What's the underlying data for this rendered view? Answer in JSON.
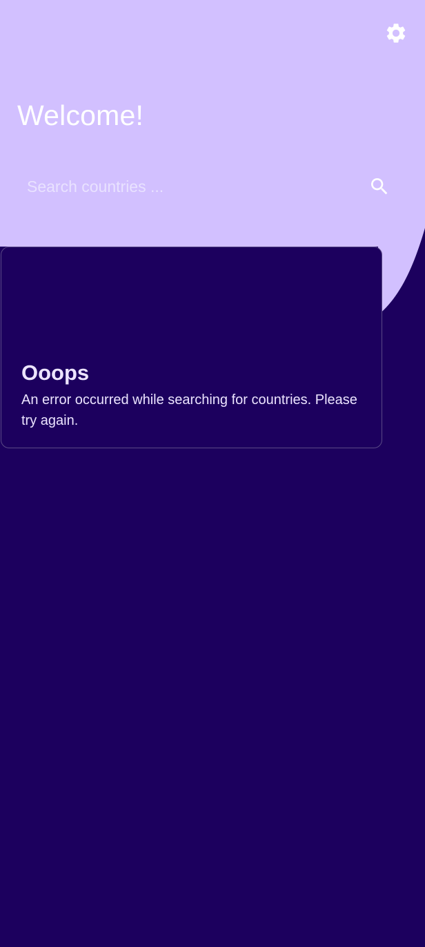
{
  "colors": {
    "header_background": "#d2c0ff",
    "screen_background": "#1c005e",
    "card_border": "#5a4a86",
    "text_light": "#ffffff",
    "card_text": "#ece4ff"
  },
  "header": {
    "title": "Welcome!",
    "settings_icon": "gear-icon"
  },
  "search": {
    "placeholder": "Search countries ...",
    "value": "",
    "search_icon": "search-icon"
  },
  "error_card": {
    "title": "Ooops",
    "message": "An error occurred while searching for countries. Please try again."
  }
}
